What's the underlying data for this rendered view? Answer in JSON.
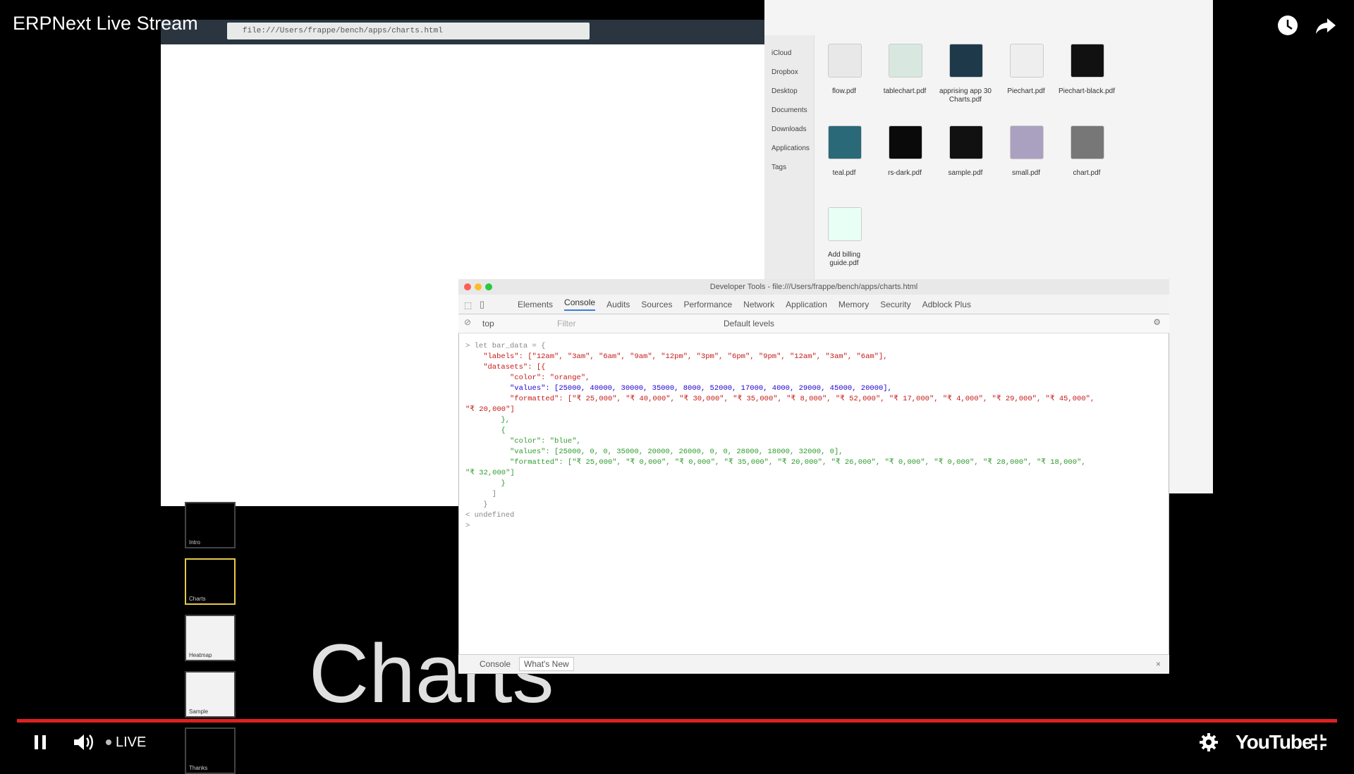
{
  "player": {
    "title": "ERPNext Live Stream",
    "live_label": "LIVE",
    "brand": "YouTube",
    "progress_fraction": 1.0
  },
  "browser": {
    "url": "file:///Users/frappe/bench/apps/charts.html"
  },
  "finder": {
    "sidebar_items": [
      "iCloud",
      "Dropbox",
      "Desktop",
      "Documents",
      "Downloads",
      "Applications",
      "Tags"
    ],
    "files": [
      {
        "name": "flow.pdf",
        "color": "#e8e8e8"
      },
      {
        "name": "tablechart.pdf",
        "color": "#d8e8e0"
      },
      {
        "name": "apprising app 30 Charts.pdf",
        "color": "#1e3a4a"
      },
      {
        "name": "Piechart.pdf",
        "color": "#eeeeee"
      },
      {
        "name": "Piechart-black.pdf",
        "color": "#111111"
      },
      {
        "name": "teal.pdf",
        "color": "#2a6a78"
      },
      {
        "name": "rs-dark.pdf",
        "color": "#0a0a0a"
      },
      {
        "name": "sample.pdf",
        "color": "#111111"
      },
      {
        "name": "small.pdf",
        "color": "#aaa0c0"
      },
      {
        "name": "chart.pdf",
        "color": "#777777"
      },
      {
        "name": "Add billing guide.pdf",
        "color": "#e8fff6"
      }
    ]
  },
  "slides": {
    "big_text": "Charts",
    "thumb_labels": [
      "Intro",
      "Charts",
      "Heatmap",
      "Sample",
      "Thanks"
    ]
  },
  "devtools": {
    "title": "Developer Tools - file:///Users/frappe/bench/apps/charts.html",
    "tabs": [
      "Elements",
      "Console",
      "Audits",
      "Sources",
      "Performance",
      "Network",
      "Application",
      "Memory",
      "Security",
      "Adblock Plus"
    ],
    "active_tab": "Console",
    "context": "top",
    "filter_placeholder": "Filter",
    "levels": "Default levels",
    "code_lines": [
      {
        "cls": "c-gray",
        "text": "> let bar_data = {"
      },
      {
        "cls": "c-red",
        "text": "    \"labels\": [\"12am\", \"3am\", \"6am\", \"9am\", \"12pm\", \"3pm\", \"6pm\", \"9pm\", \"12am\", \"3am\", \"6am\"],"
      },
      {
        "cls": "c-red",
        "text": "    \"datasets\": [{"
      },
      {
        "cls": "c-red",
        "text": "          \"color\": \"orange\","
      },
      {
        "cls": "c-blue",
        "text": "          \"values\": [25000, 40000, 30000, 35000, 8000, 52000, 17000, 4000, 29000, 45000, 20000],"
      },
      {
        "cls": "c-red",
        "text": "          \"formatted\": [\"₹ 25,000\", \"₹ 40,000\", \"₹ 30,000\", \"₹ 35,000\", \"₹ 8,000\", \"₹ 52,000\", \"₹ 17,000\", \"₹ 4,000\", \"₹ 29,000\", \"₹ 45,000\","
      },
      {
        "cls": "c-red",
        "text": "\"₹ 20,000\"]"
      },
      {
        "cls": "c-green",
        "text": "        },"
      },
      {
        "cls": "c-green",
        "text": "        {"
      },
      {
        "cls": "c-green",
        "text": "          \"color\": \"blue\","
      },
      {
        "cls": "c-green",
        "text": "          \"values\": [25000, 0, 0, 35000, 20000, 26000, 0, 0, 28000, 18000, 32000, 0],"
      },
      {
        "cls": "c-green",
        "text": "          \"formatted\": [\"₹ 25,000\", \"₹ 0,000\", \"₹ 0,000\", \"₹ 35,000\", \"₹ 20,000\", \"₹ 26,000\", \"₹ 0,000\", \"₹ 0,000\", \"₹ 28,000\", \"₹ 18,000\","
      },
      {
        "cls": "c-green",
        "text": "\"₹ 32,000\"]"
      },
      {
        "cls": "c-green",
        "text": "        }"
      },
      {
        "cls": "c-gray",
        "text": "      ]"
      },
      {
        "cls": "c-gray",
        "text": "    }"
      },
      {
        "cls": "c-gray",
        "text": "< undefined"
      },
      {
        "cls": "c-gray",
        "text": "> "
      }
    ],
    "drawer_tabs": [
      "Console",
      "What's New"
    ]
  }
}
